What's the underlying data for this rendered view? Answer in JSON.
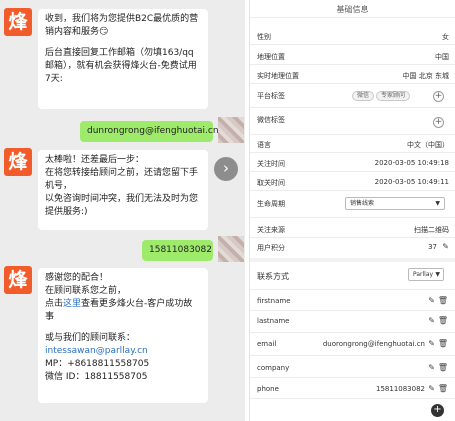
{
  "chat": {
    "avatar_char": "烽",
    "msg1": {
      "p1": "收到，我们将为您提供B2C最优质的营销内容和服务😏",
      "p2": "后台直接回复工作邮箱（勿填163/qq邮箱），就有机会获得烽火台-免费试用7天:"
    },
    "reply_email": "dunrongrong@ifenghuotai.cn",
    "msg2": {
      "p1": "太棒啦！还差最后一步：",
      "p2": "在将您转接给顾问之前，还请您留下手机号，",
      "p3": "以免咨询时间冲突，我们无法及时为您提供服务:)"
    },
    "reply_phone": "15811083082",
    "msg3": {
      "p1": "感谢您的配合！",
      "p2a": "在顾问联系您之前，",
      "p2b": "点击",
      "p2link": "这里",
      "p2c": "查看更多烽火台-客户成功故事",
      "p3": "或与我们的顾问联系：",
      "email": "intessawan@parllay.cn",
      "mp": "MP：+8618811558705",
      "wechat": "微信 ID：18811558705"
    },
    "forward_icon": "chevron-right-icon"
  },
  "panel": {
    "title": "基础信息",
    "gender": {
      "label": "性别",
      "value": "女"
    },
    "location": {
      "label": "地理位置",
      "value": "中国"
    },
    "real_location": {
      "label": "实时地理位置",
      "value": "中国 北京 东城"
    },
    "platform_tags": {
      "label": "平台标签",
      "tags": [
        "微信",
        "专家顾问"
      ]
    },
    "wechat_tags": {
      "label": "微信标签"
    },
    "language": {
      "label": "语言",
      "value": "中文（中国）"
    },
    "follow_time": {
      "label": "关注时间",
      "value": "2020-03-05 10:49:18"
    },
    "cancel_time": {
      "label": "取关时间",
      "value": "2020-03-05 10:49:11"
    },
    "lifecycle": {
      "label": "生命周期",
      "value": "销售线索"
    },
    "follow_source": {
      "label": "关注来源",
      "value": "扫描二维码"
    },
    "points": {
      "label": "用户积分",
      "value": "37"
    },
    "contact": {
      "title": "联系方式",
      "dropdown": "Parllay",
      "fields": [
        {
          "label": "firstname",
          "value": ""
        },
        {
          "label": "lastname",
          "value": ""
        },
        {
          "label": "email",
          "value": "duorongrong@ifenghuotai.cn"
        },
        {
          "label": "company",
          "value": ""
        },
        {
          "label": "phone",
          "value": "15811083082"
        }
      ]
    }
  }
}
